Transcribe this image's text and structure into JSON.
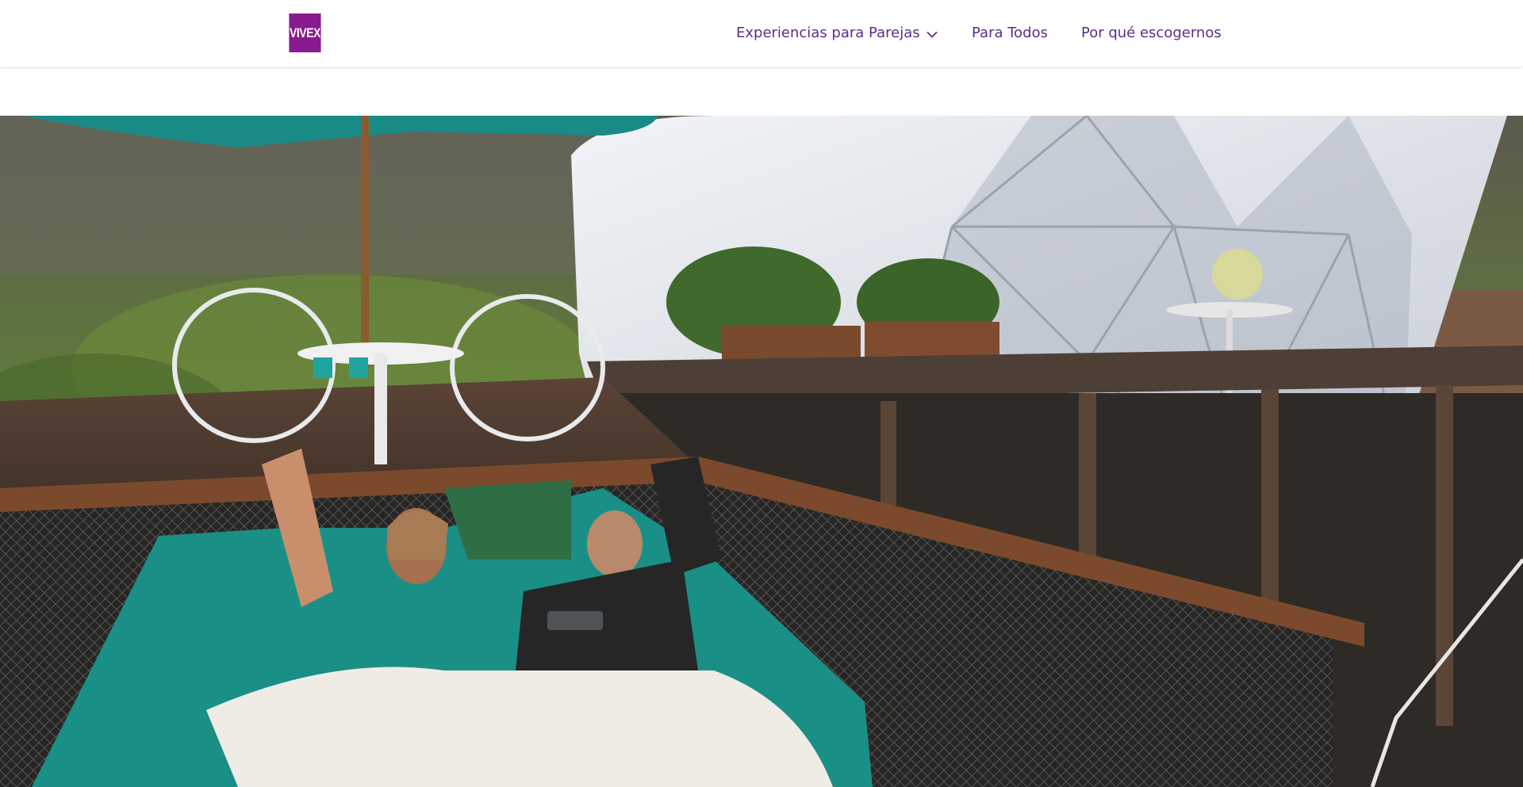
{
  "header": {
    "logo_text": "VIVEX",
    "nav": [
      {
        "label": "Experiencias para Parejas",
        "has_dropdown": true
      },
      {
        "label": "Para Todos",
        "has_dropdown": false
      },
      {
        "label": "Por qué escogernos",
        "has_dropdown": false
      }
    ]
  },
  "colors": {
    "brand_purple": "#8a1a8f",
    "nav_text": "#5c2d86"
  },
  "icons": [
    "chevron-down-icon"
  ]
}
